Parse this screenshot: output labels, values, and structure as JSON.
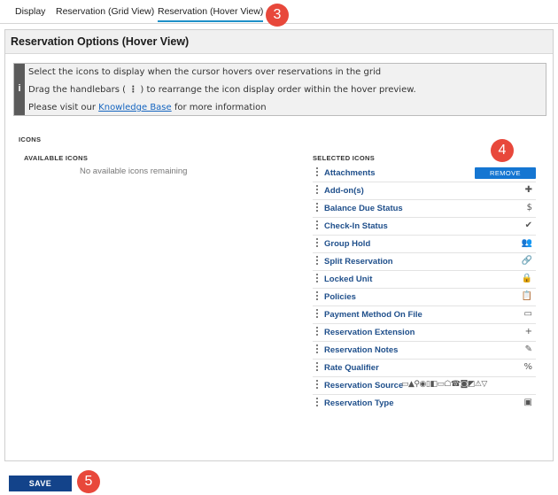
{
  "tabs": [
    {
      "label": "Display"
    },
    {
      "label": "Reservation (Grid View)"
    },
    {
      "label": "Reservation (Hover View)"
    }
  ],
  "badges": {
    "tabs": "3",
    "remove": "4",
    "save": "5"
  },
  "badge_color": "#e8483b",
  "panel": {
    "title": "Reservation Options (Hover View)",
    "info": {
      "icon": "i",
      "line1": "Select the icons to display when the cursor hovers over reservations in the grid",
      "line2_prefix": "Drag the handlebars (",
      "line2_suffix": ") to rearrange the icon display order within the hover preview.",
      "line3_prefix": "Please visit our ",
      "line3_link": "Knowledge Base",
      "line3_suffix": " for more information"
    },
    "icons_heading": "ICONS",
    "available": {
      "heading": "AVAILABLE ICONS",
      "empty": "No available icons remaining"
    },
    "selected": {
      "heading": "SELECTED ICONS",
      "remove_label": "REMOVE",
      "items": [
        {
          "label": "Attachments",
          "icon": ""
        },
        {
          "label": "Add-on(s)",
          "icon": "✚"
        },
        {
          "label": "Balance Due Status",
          "icon": "$"
        },
        {
          "label": "Check-In Status",
          "icon": "✔"
        },
        {
          "label": "Group Hold",
          "icon": "👥"
        },
        {
          "label": "Split Reservation",
          "icon": "🔗"
        },
        {
          "label": "Locked Unit",
          "icon": "🔒"
        },
        {
          "label": "Policies",
          "icon": "📋"
        },
        {
          "label": "Payment Method On File",
          "icon": "▭"
        },
        {
          "label": "Reservation Extension",
          "icon": "+"
        },
        {
          "label": "Reservation Notes",
          "icon": "✎"
        },
        {
          "label": "Rate Qualifier",
          "icon": "%"
        },
        {
          "label": "Reservation Source",
          "icon": ""
        },
        {
          "label": "Reservation Type",
          "icon": "▣"
        }
      ],
      "source_icons": "▭▲⚲◉▯◧▭☖☎◙◩⚠▽"
    }
  },
  "save_label": "SAVE",
  "colors": {
    "accent": "#1576d2",
    "save": "#13438a",
    "label": "#1f4f8b",
    "tab_underline": "#1e90c8"
  }
}
